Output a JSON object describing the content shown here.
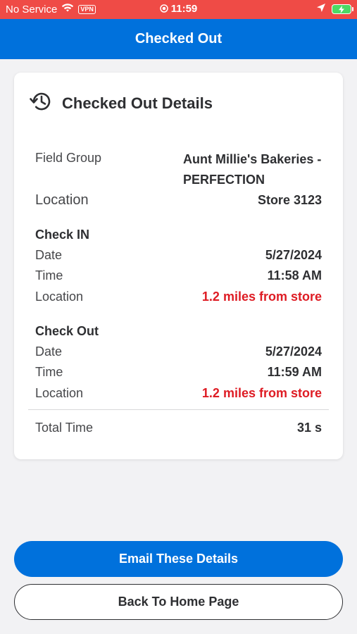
{
  "status_bar": {
    "carrier": "No Service",
    "vpn": "VPN",
    "time": "11:59"
  },
  "header": {
    "title": "Checked Out"
  },
  "card": {
    "title": "Checked Out Details",
    "field_group_label": "Field Group",
    "field_group_value_line1": "Aunt Millie's Bakeries -",
    "field_group_value_line2": "PERFECTION",
    "location_label": "Location",
    "location_value": "Store 3123",
    "check_in": {
      "title": "Check IN",
      "date_label": "Date",
      "date_value": "5/27/2024",
      "time_label": "Time",
      "time_value": "11:58 AM",
      "location_label": "Location",
      "location_value": "1.2 miles from store"
    },
    "check_out": {
      "title": "Check Out",
      "date_label": "Date",
      "date_value": "5/27/2024",
      "time_label": "Time",
      "time_value": "11:59 AM",
      "location_label": "Location",
      "location_value": "1.2 miles from store"
    },
    "total_time_label": "Total Time",
    "total_time_value": "31 s"
  },
  "buttons": {
    "email_label": "Email These Details",
    "home_label": "Back To Home Page"
  },
  "colors": {
    "status_bar": "#ef4b46",
    "header": "#0071dc",
    "primary_button": "#0071dc",
    "warning_text": "#de1c24"
  },
  "icons": {
    "history": "history-icon",
    "wifi": "wifi-icon",
    "location_arrow": "location-arrow-icon",
    "battery": "battery-charging-icon"
  }
}
